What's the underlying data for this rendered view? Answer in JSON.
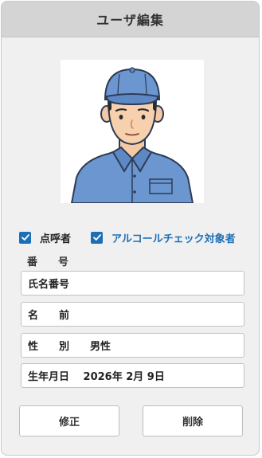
{
  "header": {
    "title": "ユーザ編集"
  },
  "photo": {
    "icon": "user-photo-worker-blue-cap"
  },
  "checkboxes": [
    {
      "label": "点呼者",
      "checked": true
    },
    {
      "label": "アルコールチェック対象者",
      "checked": true
    }
  ],
  "form": {
    "number_label": "番　　号",
    "number_placeholder": "氏名番号",
    "name_display": "名　　前",
    "gender_display": "性　　別　　男性",
    "birthdate_display": "生年月日　 2026年 2月 9日"
  },
  "buttons": {
    "edit_label": "修正",
    "delete_label": "削除"
  },
  "colors": {
    "accent": "#1c6fb6",
    "header_bg": "#d4d4d4",
    "panel_bg": "#f0f0f0"
  }
}
